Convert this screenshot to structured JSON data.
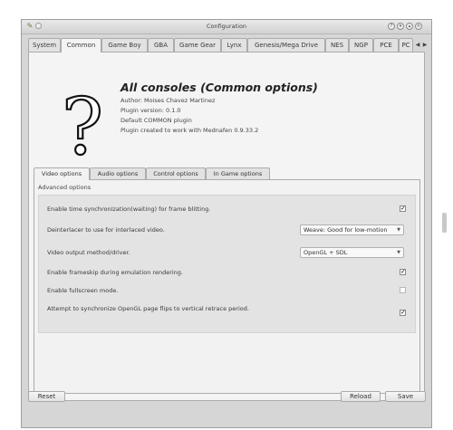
{
  "window": {
    "title": "Configuration",
    "controls": [
      "help-icon",
      "minimize-icon",
      "maximize-icon",
      "close-icon"
    ]
  },
  "tabs": [
    {
      "label": "System"
    },
    {
      "label": "Common"
    },
    {
      "label": "Game Boy"
    },
    {
      "label": "GBA"
    },
    {
      "label": "Game Gear"
    },
    {
      "label": "Lynx"
    },
    {
      "label": "Genesis/Mega Drive"
    },
    {
      "label": "NES"
    },
    {
      "label": "NGP"
    },
    {
      "label": "PCE"
    },
    {
      "label": "PC"
    }
  ],
  "active_tab": "Common",
  "header": {
    "icon": "question-mark",
    "title": "All consoles (Common options)",
    "author": "Author: Moises Chavez Martinez",
    "version": "Plugin version: 0.1.0",
    "default": "Default COMMON plugin",
    "created": "Plugin created to work with Mednafen 0.9.33.2"
  },
  "inner_tabs": [
    {
      "label": "Video options"
    },
    {
      "label": "Audio options"
    },
    {
      "label": "Control options"
    },
    {
      "label": "In Game options"
    }
  ],
  "active_inner_tab": "Video options",
  "group": {
    "label": "Advanced options",
    "options": [
      {
        "label": "Enable time synchronization(waiting) for frame blitting.",
        "checked": true
      },
      {
        "label": "Deinterlacer to use for interlaced video.",
        "value": "Weave: Good for low-motion"
      },
      {
        "label": "Video output method/driver.",
        "value": "OpenGL + SDL"
      },
      {
        "label": "Enable frameskip during emulation rendering.",
        "checked": true
      },
      {
        "label": "Enable fullscreen mode.",
        "checked": false
      },
      {
        "label": "Attempt to synchronize OpenGL page flips to vertical retrace period.",
        "checked": true
      }
    ]
  },
  "buttons": {
    "reset": "Reset",
    "reload": "Reload",
    "save": "Save"
  },
  "check_mark": "✓"
}
